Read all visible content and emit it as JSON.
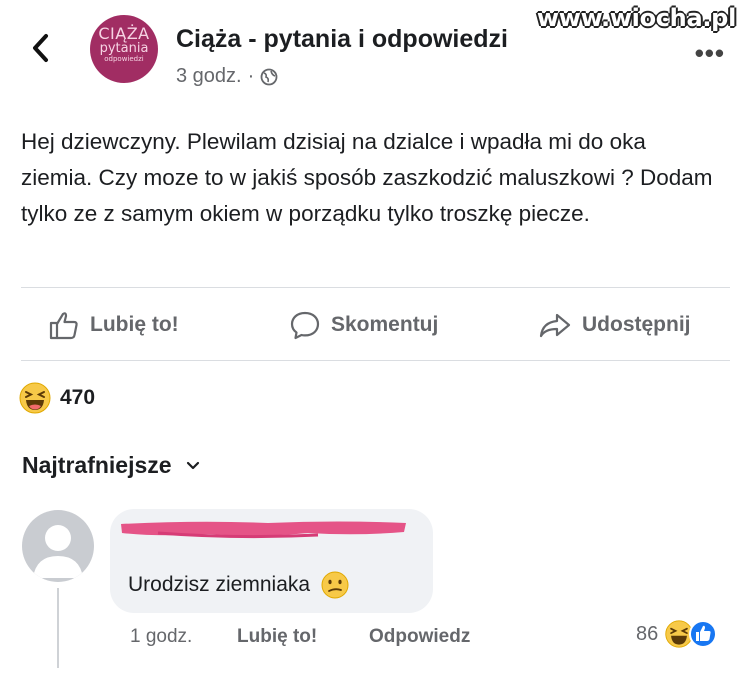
{
  "watermark": "www.wiocha.pl",
  "header": {
    "page_name": "Ciąża - pytania i odpowiedzi",
    "logo": {
      "line1": "CIĄŻA",
      "line2": "pytania",
      "line3": "odpowiedzi",
      "color": "#a12d63"
    },
    "time": "3 godz.",
    "separator": "·",
    "audience_icon": "globe-icon",
    "more": "•••"
  },
  "post": {
    "text": "Hej dziewczyny. Plewilam dzisiaj na dzialce i wpadła mi do oka ziemia. Czy moze to w jakiś sposób zaszkodzić maluszkowi ? Dodam tylko ze z samym okiem w porządku tylko troszkę piecze."
  },
  "actions": {
    "like": "Lubię to!",
    "comment": "Skomentuj",
    "share": "Udostępnij"
  },
  "reactions": {
    "type": "haha",
    "count": "470"
  },
  "comments": {
    "sort_label": "Najtrafniejsze",
    "items": [
      {
        "text": "Urodzisz ziemniaka",
        "emoji": "confused-face",
        "time": "1 godz.",
        "like": "Lubię to!",
        "reply": "Odpowiedz",
        "reaction_count": "86"
      }
    ]
  }
}
